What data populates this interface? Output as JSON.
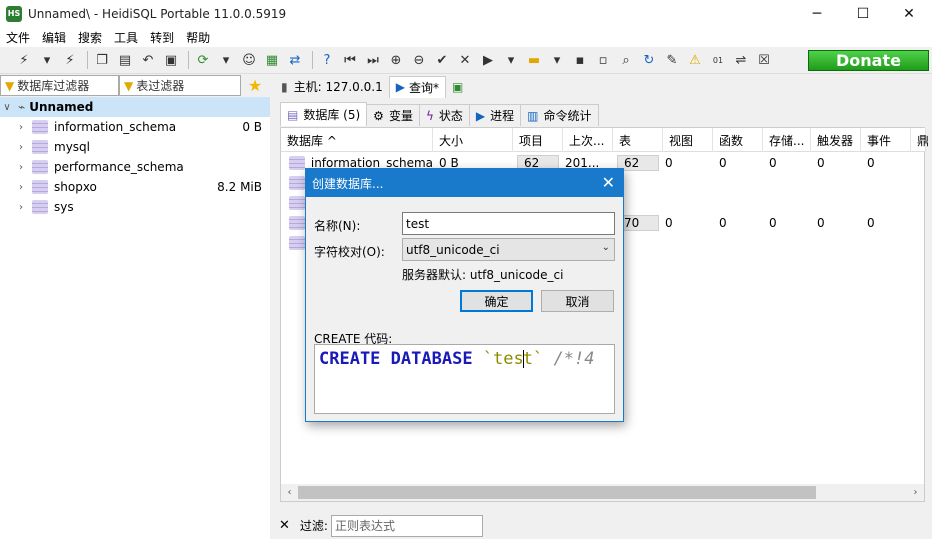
{
  "window": {
    "title": "Unnamed\\ - HeidiSQL Portable 11.0.0.5919",
    "app_icon_text": "HS",
    "minimize": "─",
    "maximize": "☐",
    "close": "✕"
  },
  "menu": [
    "文件",
    "编辑",
    "搜索",
    "工具",
    "转到",
    "帮助"
  ],
  "toolbar": {
    "icons": [
      "plug",
      "plug-disconnect",
      "copy",
      "paste",
      "undo",
      "print",
      "refresh",
      "users",
      "export",
      "import",
      "help",
      "first",
      "last",
      "add",
      "remove",
      "check",
      "cancel",
      "run",
      "run-dropdown",
      "folder",
      "save",
      "save-all",
      "search",
      "replace",
      "clean",
      "warning",
      "binary",
      "wrap",
      "close-tab"
    ],
    "donate_label": "Donate"
  },
  "left": {
    "db_filter_placeholder": "数据库过滤器",
    "table_filter_placeholder": "表过滤器",
    "root_label": "Unnamed",
    "databases": [
      {
        "name": "information_schema",
        "size": "0 B"
      },
      {
        "name": "mysql",
        "size": ""
      },
      {
        "name": "performance_schema",
        "size": ""
      },
      {
        "name": "shopxo",
        "size": "8.2 MiB"
      },
      {
        "name": "sys",
        "size": ""
      }
    ]
  },
  "right": {
    "host_tab": "主机: 127.0.0.1",
    "query_tab": "查询*",
    "sub_tabs": [
      "数据库 (5)",
      "变量",
      "状态",
      "进程",
      "命令统计"
    ],
    "columns": [
      "数据库 ^",
      "大小",
      "项目",
      "上次...",
      "表",
      "视图",
      "函数",
      "存储...",
      "触发器",
      "事件",
      "鼎"
    ],
    "rows": [
      {
        "name": "information_schema",
        "size": "0 B",
        "items": "62",
        "last": "201...",
        "tables": "62",
        "views": "0",
        "funcs": "0",
        "procs": "0",
        "triggers": "0",
        "events": "0"
      },
      {
        "name": "",
        "size": "",
        "items": "",
        "last": "",
        "tables": "70",
        "views": "0",
        "funcs": "0",
        "procs": "0",
        "triggers": "0",
        "events": "0"
      }
    ],
    "filter_label": "过滤:",
    "filter_placeholder": "正则表达式"
  },
  "dialog": {
    "title": "创建数据库...",
    "name_label": "名称(N):",
    "name_value": "test",
    "collation_label": "字符校对(O):",
    "collation_value": "utf8_unicode_ci",
    "server_default": "服务器默认: utf8_unicode_ci",
    "ok": "确定",
    "cancel": "取消",
    "code_label": "CREATE 代码:",
    "code_kw1": "CREATE",
    "code_kw2": "DATABASE",
    "code_ident_a": "`tes",
    "code_ident_b": "t`",
    "code_comment": "/*!4"
  }
}
